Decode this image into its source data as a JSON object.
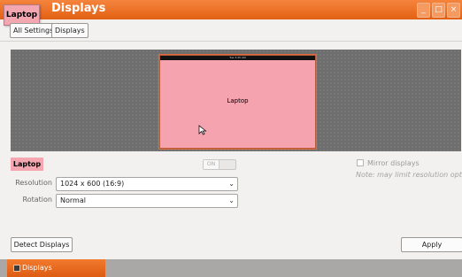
{
  "window": {
    "title": "Displays",
    "popup_label": "Laptop",
    "controls": [
      "_",
      "□",
      "×"
    ]
  },
  "toolbar": {
    "all_settings": "All Settings",
    "displays": "Displays"
  },
  "monitor": {
    "top_caption": "Tue 3:45 AM",
    "label": "Laptop"
  },
  "display": {
    "name": "Laptop",
    "toggle_state": "ON",
    "mirror_label": "Mirror displays",
    "note": "Note: may limit resolution options",
    "resolution_label": "Resolution",
    "resolution_value": "1024 x 600 (16:9)",
    "rotation_label": "Rotation",
    "rotation_value": "Normal"
  },
  "buttons": {
    "detect": "Detect Displays",
    "apply": "Apply"
  },
  "taskbar": {
    "item_label": "Displays"
  }
}
